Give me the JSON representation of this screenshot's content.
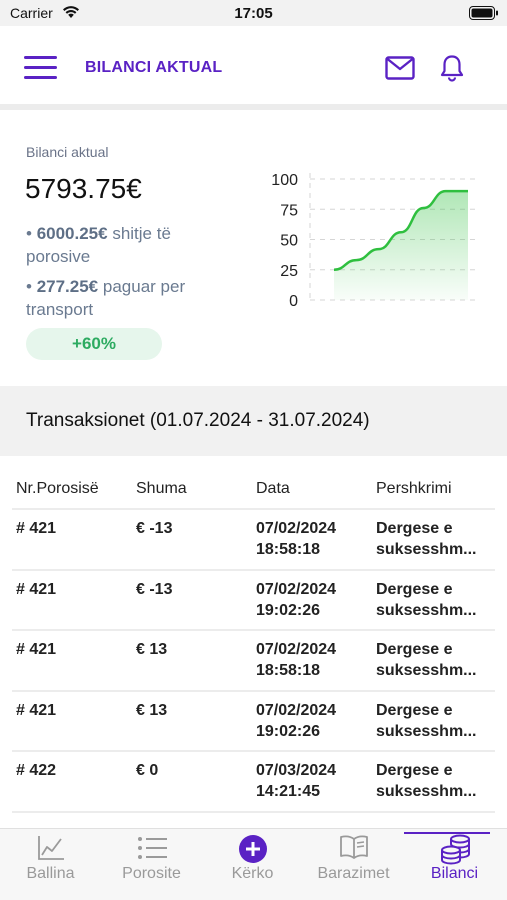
{
  "status_bar": {
    "carrier": "Carrier",
    "time": "17:05"
  },
  "header": {
    "title": "BILANCI AKTUAL"
  },
  "balance": {
    "label": "Bilanci aktual",
    "amount": "5793.75€",
    "sales_amount": "6000.25€",
    "sales_text": "shitje të porosive",
    "transport_amount": "277.25€",
    "transport_text": "paguar per transport",
    "growth": "+60%"
  },
  "chart_data": {
    "type": "area",
    "y_ticks": [
      "100",
      "75",
      "50",
      "25",
      "0"
    ],
    "ylim": [
      0,
      100
    ],
    "x": [
      0,
      1,
      2,
      3,
      4,
      5,
      6
    ],
    "values": [
      25,
      33,
      42,
      56,
      76,
      90,
      90
    ],
    "grid": true,
    "color": "#2fbf3f"
  },
  "transactions": {
    "title": "Transaksionet (01.07.2024 - 31.07.2024)",
    "columns": [
      "Nr.Porosisë",
      "Shuma",
      "Data",
      "Pershkrimi"
    ],
    "rows": [
      {
        "order": "# 421",
        "amount": "€ -13",
        "date": "07/02/2024",
        "time": "18:58:18",
        "desc1": "Dergese e",
        "desc2": "suksesshm..."
      },
      {
        "order": "# 421",
        "amount": "€ -13",
        "date": "07/02/2024",
        "time": "19:02:26",
        "desc1": "Dergese e",
        "desc2": "suksesshm..."
      },
      {
        "order": "# 421",
        "amount": "€ 13",
        "date": "07/02/2024",
        "time": "18:58:18",
        "desc1": "Dergese e",
        "desc2": "suksesshm..."
      },
      {
        "order": "# 421",
        "amount": "€ 13",
        "date": "07/02/2024",
        "time": "19:02:26",
        "desc1": "Dergese e",
        "desc2": "suksesshm..."
      },
      {
        "order": "# 422",
        "amount": "€ 0",
        "date": "07/03/2024",
        "time": "14:21:45",
        "desc1": "Dergese e",
        "desc2": "suksesshm..."
      }
    ]
  },
  "tabs": [
    {
      "label": "Ballina",
      "icon": "chart-line-icon"
    },
    {
      "label": "Porosite",
      "icon": "list-icon"
    },
    {
      "label": "Kërko",
      "icon": "plus-circle-icon"
    },
    {
      "label": "Barazimet",
      "icon": "book-icon"
    },
    {
      "label": "Bilanci",
      "icon": "coins-icon",
      "active": true
    }
  ],
  "colors": {
    "accent": "#5a22c4",
    "positive": "#2dab61",
    "badge_bg": "#e6f6ec"
  }
}
